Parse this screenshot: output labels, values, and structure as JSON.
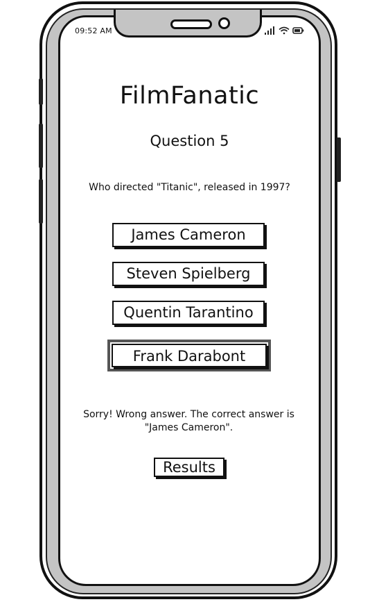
{
  "status_bar": {
    "time": "09:52 AM",
    "icons": [
      "signal-icon",
      "wifi-icon",
      "battery-icon"
    ]
  },
  "app": {
    "title": "FilmFanatic"
  },
  "quiz": {
    "question_number": "Question 5",
    "question_text": "Who directed \"Titanic\", released in 1997?",
    "answers": [
      {
        "label": "James Cameron"
      },
      {
        "label": "Steven Spielberg"
      },
      {
        "label": "Quentin Tarantino"
      },
      {
        "label": "Frank Darabont",
        "selected": true
      }
    ],
    "feedback": "Sorry! Wrong answer. The correct answer is \"James Cameron\".",
    "results_label": "Results"
  }
}
